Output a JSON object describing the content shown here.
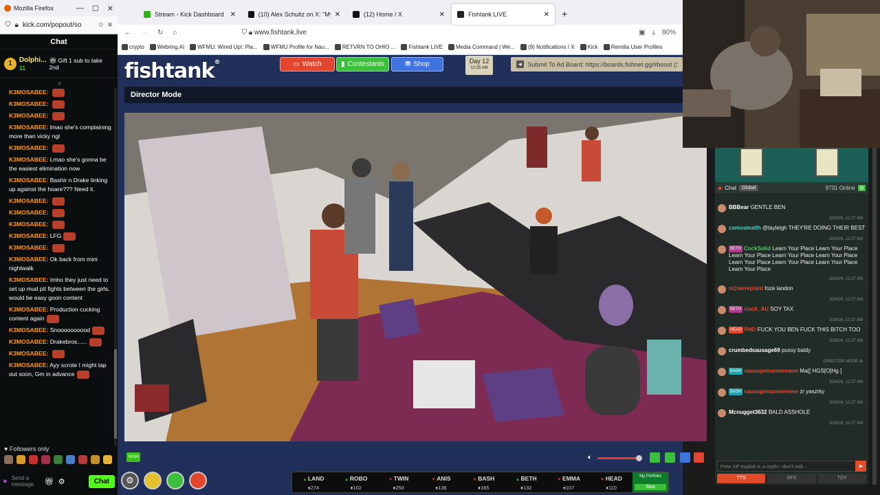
{
  "kick": {
    "window_title": "Mozilla Firefox",
    "url": "kick.com/popout/so",
    "chat_title": "Chat",
    "pinned": {
      "user": "Dolphi...",
      "subs": "11",
      "gift": "Gift 1 sub to take 2nd"
    },
    "messages": [
      {
        "user": "K3MOSABEE:",
        "text": "",
        "emote": true
      },
      {
        "user": "K3MOSABEE:",
        "text": "",
        "emote": true
      },
      {
        "user": "K3MOSABEE:",
        "text": "",
        "emote": true
      },
      {
        "user": "K3MOSABEE:",
        "text": "lmao she's complaining more than vicky ngl",
        "emote": false
      },
      {
        "user": "K3MOSABEE:",
        "text": "",
        "emote": true
      },
      {
        "user": "K3MOSABEE:",
        "text": "Lmao she's gonna be the easiest elimination now",
        "emote": false
      },
      {
        "user": "K3MOSABEE:",
        "text": "Bashir n Drake linking up against the hoare??? Need it.",
        "emote": false
      },
      {
        "user": "K3MOSABEE:",
        "text": "",
        "emote": true
      },
      {
        "user": "K3MOSABEE:",
        "text": "",
        "emote": true
      },
      {
        "user": "K3MOSABEE:",
        "text": "",
        "emote": true
      },
      {
        "user": "K3MOSABEE:",
        "text": "LFG",
        "emote": true
      },
      {
        "user": "K3MOSABEE:",
        "text": "",
        "emote": true
      },
      {
        "user": "K3MOSABEE:",
        "text": "Ok back from mini nightwalk",
        "emote": false
      },
      {
        "user": "K3MOSABEE:",
        "text": "Imho they just need to set up mud pit fights between the girls, would be easy goon content",
        "emote": false
      },
      {
        "user": "K3MOSABEE:",
        "text": "Production cucking content again",
        "emote": true
      },
      {
        "user": "K3MOSABEE:",
        "text": "Snoooooooood",
        "emote": true
      },
      {
        "user": "K3MOSABEE:",
        "text": "Drakebros......",
        "emote": true
      },
      {
        "user": "K3MOSABEE:",
        "text": "",
        "emote": true
      },
      {
        "user": "K3MOSABEE:",
        "text": "Ayy scrote I might tap out soon, Gm in advance",
        "emote": true
      }
    ],
    "followers_only": "Followers only",
    "send_placeholder": "Send a message",
    "chat_button": "Chat"
  },
  "browser": {
    "tabs": [
      {
        "label": "Stream - Kick Dashboard",
        "active": false
      },
      {
        "label": "(10) Alex Schultz on X: \"My Ne",
        "active": false
      },
      {
        "label": "(12) Home / X",
        "active": false
      },
      {
        "label": "Fishtank LIVE",
        "active": true
      }
    ],
    "new_tab": "+",
    "url": "www.fishtank.live",
    "zoom": "80%",
    "bookmarks": [
      "crypto",
      "Webring.AI",
      "WFMU: Wired Up!: Pla...",
      "WFMU Profile for Nau...",
      "RETVRN TO OHIO ...",
      "Fishtank LIVE",
      "Media Command | We...",
      "(9) Notifications / X",
      "Kick",
      "Remilia User Profiles"
    ]
  },
  "fishtank": {
    "logo": "fishtank",
    "nav": {
      "watch": "Watch",
      "contestants": "Contestants",
      "shop": "Shop"
    },
    "day": {
      "label": "Day 12",
      "time": "12:25 AM"
    },
    "adboard": "Submit To Ad Board: https://boards.fishnet.gg/#boost (S",
    "director_mode": "Director Mode",
    "quality": "HIGH",
    "stocks": [
      {
        "name": "LAND",
        "price": "274",
        "dir": "up"
      },
      {
        "name": "ROBO",
        "price": "102",
        "dir": "up"
      },
      {
        "name": "TWIN",
        "price": "250",
        "dir": "down"
      },
      {
        "name": "ANIS",
        "price": "136",
        "dir": "down"
      },
      {
        "name": "BASH",
        "price": "165",
        "dir": "down"
      },
      {
        "name": "BETH",
        "price": "132",
        "dir": "up"
      },
      {
        "name": "EMMA",
        "price": "107",
        "dir": "down"
      },
      {
        "name": "HEAD",
        "price": "110",
        "dir": "down"
      }
    ],
    "portfolio": {
      "label": "My Portfolio",
      "value": "Stox"
    }
  },
  "site_chat": {
    "title": "Chat",
    "scope": "Global",
    "online": "9731 Online",
    "messages": [
      {
        "user": "BBBear",
        "badge": "",
        "text": "GENTLE BEN",
        "ts": "3/26/26, 12:27 AM",
        "color": "#ffffff"
      },
      {
        "user": "camostealth",
        "badge": "",
        "text": "@tayleigh THEY'RE DOING THEIR BEST",
        "ts": "3/26/26, 12:27 AM",
        "color": "#3bd6c6"
      },
      {
        "user": "CockSolid",
        "badge": "BETH",
        "text": "Learn Your Place Learn Your Place Learn Your Place Learn Your Place Learn Your Place Learn Your Place Learn Your Place Learn Your Place Learn Your Place",
        "ts": "3/26/26, 12:27 AM",
        "color": "#4fc66b"
      },
      {
        "user": "n@wereplant",
        "badge": "",
        "text": "foze landon",
        "ts": "3/26/26, 12:27 AM",
        "color": "#e2462e"
      },
      {
        "user": "slack_AU",
        "badge": "BETH",
        "text": "SOY TAX",
        "ts": "3/26/26, 12:27 AM",
        "color": "#e2462e"
      },
      {
        "user": "PHD",
        "badge": "HEAD",
        "text": "FUCK YOU BEN FUCK THIS BITCH TOO",
        "ts": "3/26/26, 12:27 AM",
        "color": "#e2462e"
      },
      {
        "user": "crumbedsausage69",
        "badge": "",
        "text": "pussy baldy",
        "ts": "DIRECTOR MODE ⊕",
        "color": "#ffffff"
      },
      {
        "user": "sausagemanweewee",
        "badge": "BASH",
        "text": "Ma{[ HGS[O]Hg ]",
        "ts": "3/26/26, 12:27 AM",
        "color": "#e2462e"
      },
      {
        "user": "sausagemanweewee",
        "badge": "BASH",
        "text": "zr yaszrky",
        "ts": "3/26/26, 12:27 AM",
        "color": "#e2462e"
      },
      {
        "user": "Mcnugget3632",
        "badge": "",
        "text": "BALD ASSHOLE",
        "ts": "3/26/26, 12:27 AM",
        "color": "#ffffff"
      }
    ],
    "input_placeholder": "Free XP exploit is a myth-- don't ask...",
    "tabs": [
      "TTS",
      "SFX",
      "TOY"
    ]
  }
}
